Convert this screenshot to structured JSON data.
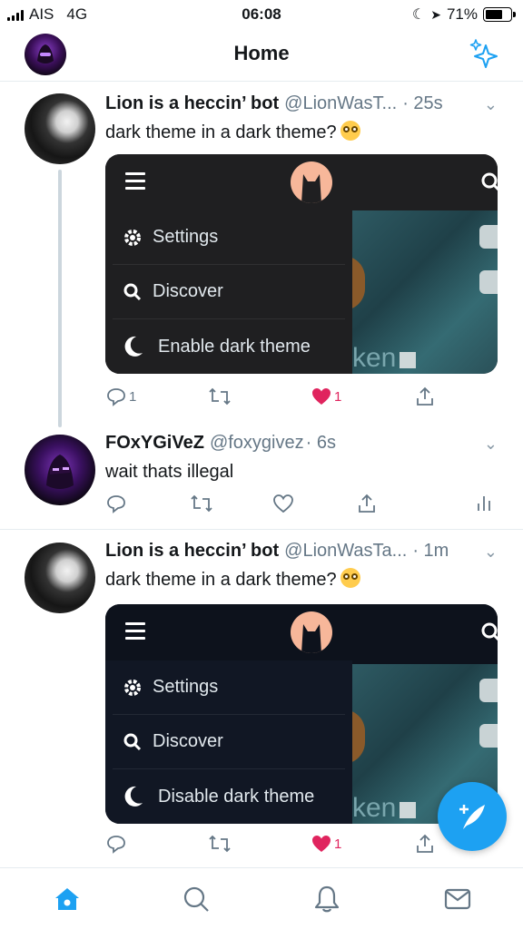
{
  "status_bar": {
    "carrier": "AIS",
    "network": "4G",
    "time": "06:08",
    "battery": "71%",
    "battery_level": 0.71
  },
  "header": {
    "title": "Home",
    "avatar_icon": "user-avatar",
    "sparkle_icon": "sparkle-icon"
  },
  "tweets": [
    {
      "name": "Lion is a heccin’ bot",
      "handle": "@LionWasT...",
      "time": "· 25s",
      "text": "dark theme in a dark theme?",
      "card": {
        "items": [
          "Settings",
          "Discover",
          "Enable dark theme"
        ],
        "image_text": "ken",
        "theme": "dark-gray"
      },
      "replies": "1",
      "likes": "1",
      "liked": true
    },
    {
      "name": "FOxYGiVeZ",
      "handle": "@foxygivez",
      "time": "· 6s",
      "text": "wait thats illegal",
      "replies": "",
      "likes": "",
      "liked": false
    },
    {
      "name": "Lion is a heccin’ bot",
      "handle": "@LionWasTa...",
      "time": "· 1m",
      "text": "dark theme in a dark theme?",
      "card": {
        "items": [
          "Settings",
          "Discover",
          "Disable dark theme"
        ],
        "image_text": "ken",
        "theme": "dark-navy"
      },
      "replies": "",
      "likes": "1",
      "liked": true
    }
  ],
  "tabbar": {
    "tabs": [
      "home-icon",
      "search-icon",
      "notifications-icon",
      "messages-icon"
    ],
    "active": "home-icon"
  },
  "colors": {
    "accent": "#1da1f2",
    "like": "#e0245e",
    "card_gray": "#1f1f21",
    "card_navy": "#0d121c"
  }
}
